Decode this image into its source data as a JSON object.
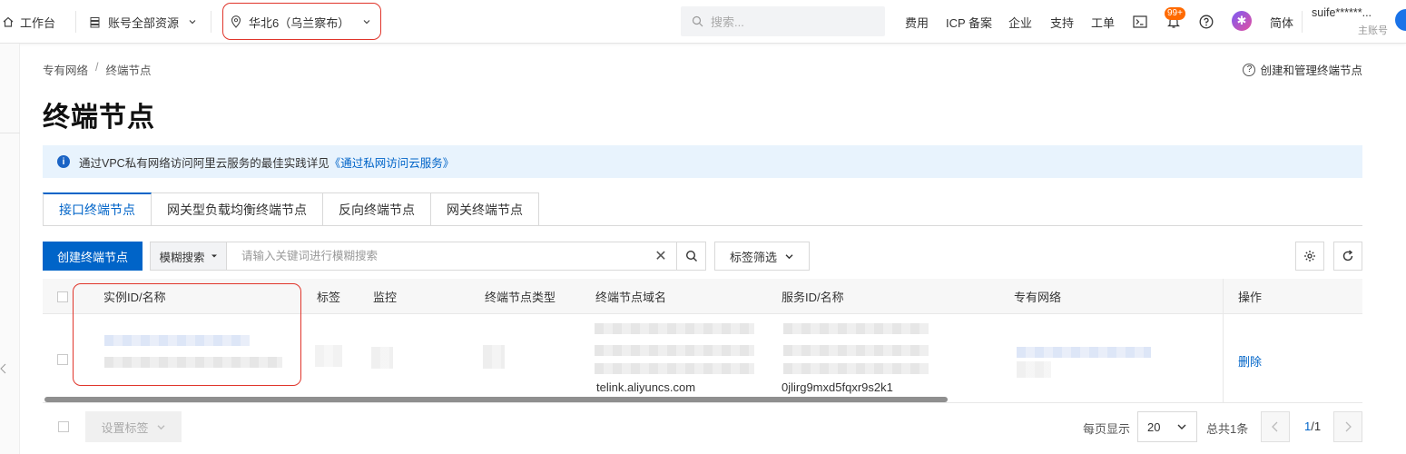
{
  "topbar": {
    "workbench": "工作台",
    "resource_group": "账号全部资源",
    "region": "华北6（乌兰察布）",
    "search_placeholder": "搜索...",
    "nav": [
      "费用",
      "ICP 备案",
      "企业",
      "支持",
      "工单"
    ],
    "badge": "99+",
    "lang": "简体",
    "user_name": "suife******...",
    "user_role": "主账号"
  },
  "breadcrumb": [
    "专有网络",
    "/",
    "终端节点"
  ],
  "help_link": "创建和管理终端节点",
  "page_title": "终端节点",
  "notice": {
    "text": "通过VPC私有网络访问阿里云服务的最佳实践详见",
    "link": "《通过私网访问云服务》"
  },
  "tabs": [
    "接口终端节点",
    "网关型负载均衡终端节点",
    "反向终端节点",
    "网关终端节点"
  ],
  "toolbar": {
    "create_button": "创建终端节点",
    "search_mode": "模糊搜索",
    "search_placeholder": "请输入关键词进行模糊搜索",
    "tag_filter": "标签筛选"
  },
  "table": {
    "columns": [
      "实例ID/名称",
      "标签",
      "监控",
      "终端节点类型",
      "终端节点域名",
      "服务ID/名称",
      "专有网络",
      "操作"
    ],
    "row": {
      "domain_suffix": "telink.aliyuncs.com",
      "service_id_suffix": "0jlirg9mxd5fqxr9s2k1",
      "action": "删除"
    }
  },
  "footer": {
    "set_tags": "设置标签",
    "per_page_label": "每页显示",
    "page_size": "20",
    "total": "总共1条",
    "page_indicator_current": "1",
    "page_indicator_total": "/1"
  },
  "colors": {
    "primary": "#0064c8",
    "highlight": "#e0352b",
    "notice_bg": "#e8f3fd"
  }
}
